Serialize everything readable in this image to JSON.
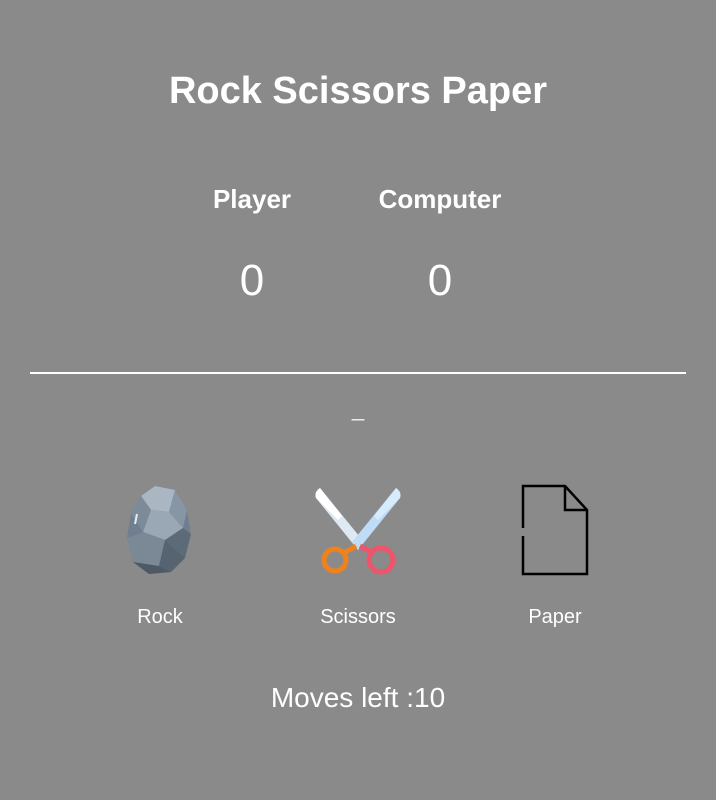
{
  "game": {
    "title": "Rock Scissors Paper",
    "player_label": "Player",
    "computer_label": "Computer",
    "player_score": "0",
    "computer_score": "0",
    "result_text": "_",
    "moves_label": "Moves left :",
    "moves_left": "10"
  },
  "choices": [
    {
      "label": "Rock",
      "icon": "rock-icon"
    },
    {
      "label": "Scissors",
      "icon": "scissors-icon"
    },
    {
      "label": "Paper",
      "icon": "paper-icon"
    }
  ],
  "colors": {
    "background": "#8a8a8a",
    "text": "#ffffff",
    "scissors_left_handle": "#f0821e",
    "scissors_right_handle": "#f0546a",
    "rock": "#6f7f8f"
  }
}
